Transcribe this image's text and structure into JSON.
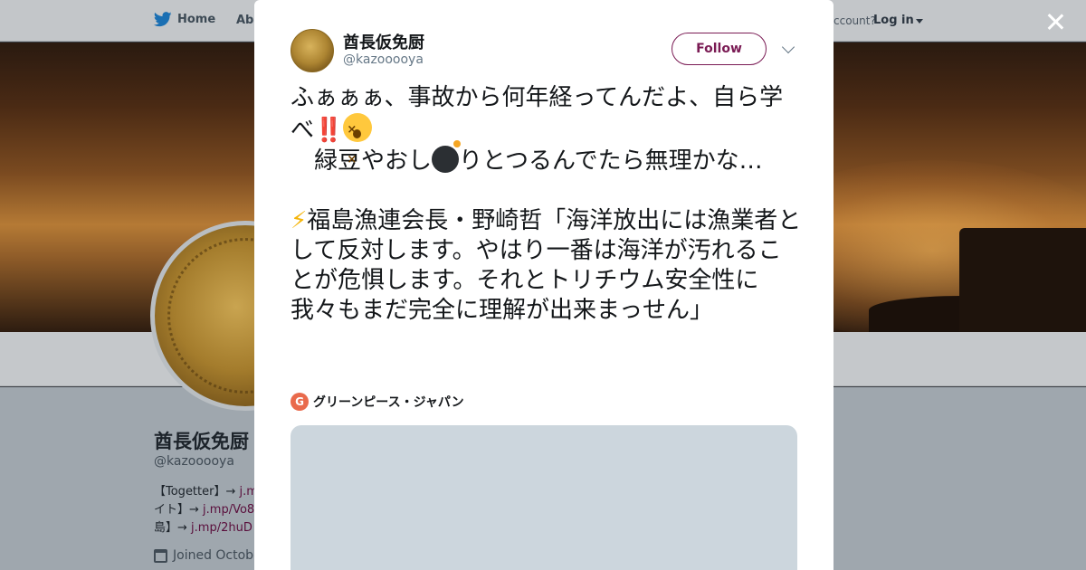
{
  "background": {
    "nav": {
      "home": "Home",
      "about": "Abo",
      "account": "ccount?",
      "login": "Log in"
    },
    "profile": {
      "name": "酋長仮免厨",
      "handle": "@kazooooya",
      "bio_line1": "【Togetter】→ ",
      "bio_link1": "j.m",
      "bio_line2": "イト】→ ",
      "bio_link2": "j.mp/Vo8",
      "bio_line3": "島】→ ",
      "bio_link3": "j.mp/2huD",
      "joined": "Joined Octobe"
    }
  },
  "modal": {
    "author": {
      "name": "酋長仮免厨",
      "handle": "@kazooooya"
    },
    "follow_label": "Follow",
    "tweet": {
      "part1": "ふぁぁぁ、事故から何年経ってんだよ、自ら学べ",
      "exclaim": "‼️",
      "part2": "\n　緑豆やおし",
      "part3": "りとつるんでたら無理かな…\n\n",
      "bolt": "⚡",
      "part4": "福島漁連会長・野崎哲「海洋放出には漁業者として反対します。やはり一番は海洋が汚れることが危惧します。それとトリチウム安全性に我々もまだ完全に理解が出来まっせん」"
    },
    "card": {
      "source_logo": "G",
      "source_name": "グリーンピース・ジャパン"
    }
  },
  "colors": {
    "accent": "#7a1b54",
    "overlay": "#3a3f44",
    "media_placeholder": "#ccd6dd"
  },
  "icons": [
    "twitter-bird-icon",
    "close-icon",
    "chevron-down-icon",
    "calendar-icon",
    "bomb-emoji-icon",
    "dizzy-face-emoji-icon"
  ]
}
